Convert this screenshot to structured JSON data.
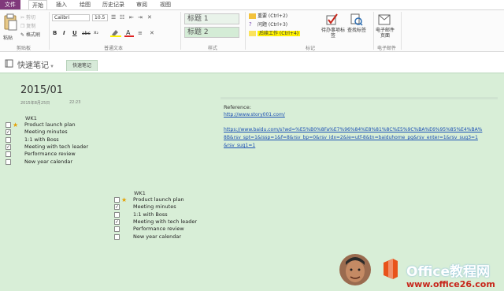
{
  "tabs": [
    "文件",
    "开始",
    "插入",
    "绘图",
    "历史记录",
    "审阅",
    "视图"
  ],
  "clipboard": {
    "paste": "粘贴",
    "cut": "剪切",
    "copy": "复制",
    "format_painter": "格式刷",
    "group": "剪贴板"
  },
  "font": {
    "family": "Calibri",
    "size": "10.5",
    "group": "普通文本",
    "bold": "B",
    "italic": "I",
    "underline": "U",
    "strike": "abc",
    "sub": "x₂"
  },
  "styles": {
    "heading1": "标题 1",
    "heading2": "标题 2",
    "group": "样式"
  },
  "tags": {
    "items": [
      "重要 (Ctrl+2)",
      "问题 (Ctrl+3)",
      "后续工作 (Ctrl+4)"
    ],
    "todo": "待办事项标签",
    "find": "查找标签",
    "group": "标记"
  },
  "email": {
    "button": "电子邮件页面",
    "group": "电子邮件"
  },
  "notebook": {
    "title": "快速笔记",
    "section_tab": "快速笔记"
  },
  "page": {
    "title": "2015/01",
    "date": "2015年8月25日",
    "time": "22:23"
  },
  "list1": {
    "heading": "WK1",
    "items": [
      {
        "text": "Product launch plan",
        "checked": false,
        "star": true
      },
      {
        "text": "Meeting minutes",
        "checked": true,
        "star": false
      },
      {
        "text": "1:1 with Boss",
        "checked": false,
        "star": false
      },
      {
        "text": "Meeting with tech leader",
        "checked": true,
        "star": false
      },
      {
        "text": "Performance review",
        "checked": false,
        "star": false
      },
      {
        "text": "New year calendar",
        "checked": false,
        "star": false
      }
    ]
  },
  "list2": {
    "heading": "WK1",
    "items": [
      {
        "text": "Product launch plan",
        "checked": false,
        "star": true
      },
      {
        "text": "Meeting minutes",
        "checked": true,
        "star": false
      },
      {
        "text": "1:1 with Boss",
        "checked": false,
        "star": false
      },
      {
        "text": "Meeting with tech leader",
        "checked": true,
        "star": false
      },
      {
        "text": "Performance review",
        "checked": false,
        "star": false
      },
      {
        "text": "New year calendar",
        "checked": false,
        "star": false
      }
    ]
  },
  "reference": {
    "label": "Reference:",
    "link1": "http://www.story001.com/",
    "link2_lines": [
      "https://www.baidu.com/s?wd=%E5%B0%8Fa%E7%96%84%E8%81%8C%E5%9C%BA%E6%95%85%E4%BA%",
      "8B&rsv_spt=1&issp=1&f=8&rsv_bp=0&rsv_idx=2&ie=utf-8&tn=baiduhome_pg&rsv_enter=1&rsv_sug3=1",
      "&rsv_sug1=1"
    ]
  },
  "watermark": {
    "brand": "Office教程网",
    "url": "www.office26.com"
  },
  "colors": {
    "page_bg": "#d8eed7",
    "file_tab": "#80397b",
    "link": "#1a4fb3",
    "highlight": "#fff200"
  }
}
